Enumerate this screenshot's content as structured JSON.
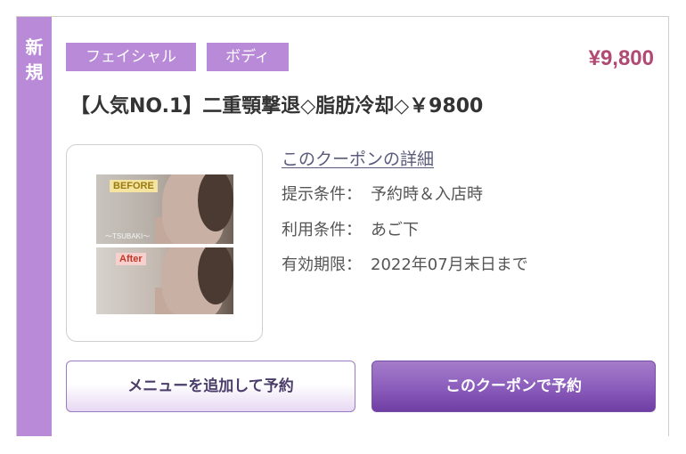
{
  "badge": {
    "line1": "新",
    "line2": "規"
  },
  "tags": [
    "フェイシャル",
    "ボディ"
  ],
  "price": "¥9,800",
  "title": "【人気NO.1】二重顎撃退◇脂肪冷却◇￥9800",
  "image": {
    "before_label": "BEFORE",
    "after_label": "After",
    "watermark": "〜TSUBAKI〜"
  },
  "detail_link": "このクーポンの詳細",
  "conditions": [
    {
      "label": "提示条件：",
      "value": "予約時＆入店時"
    },
    {
      "label": "利用条件：",
      "value": "あご下"
    },
    {
      "label": "有効期限：",
      "value": "2022年07月末日まで"
    }
  ],
  "buttons": {
    "add_menu": "メニューを追加して予約",
    "reserve_coupon": "このクーポンで予約"
  },
  "colors": {
    "accent": "#b98ad8",
    "price": "#b14a73",
    "primary_button": "#8d5fbd"
  }
}
